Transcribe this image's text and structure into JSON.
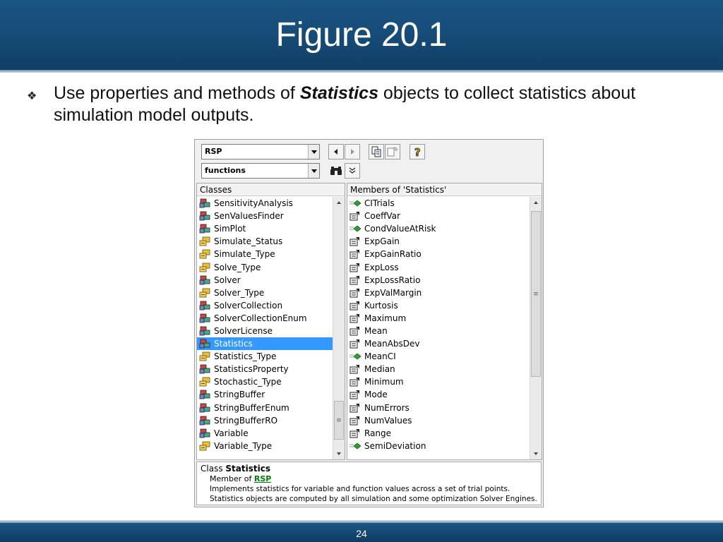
{
  "slide": {
    "title": "Figure 20.1",
    "bullet_part1": "Use properties and methods of ",
    "bullet_emphasis": "Statistics",
    "bullet_part2": " objects to collect statistics about simulation model outputs.",
    "page_number": "24"
  },
  "browser": {
    "library_combo_value": "RSP",
    "search_combo_value": "functions",
    "classes_header": "Classes",
    "members_header": "Members of 'Statistics'",
    "classes": [
      {
        "label": "SensitivityAnalysis",
        "icon": "class-icon"
      },
      {
        "label": "SenValuesFinder",
        "icon": "class-icon"
      },
      {
        "label": "SimPlot",
        "icon": "class-icon"
      },
      {
        "label": "Simulate_Status",
        "icon": "enum-icon"
      },
      {
        "label": "Simulate_Type",
        "icon": "enum-icon"
      },
      {
        "label": "Solve_Type",
        "icon": "enum-icon"
      },
      {
        "label": "Solver",
        "icon": "class-icon"
      },
      {
        "label": "Solver_Type",
        "icon": "enum-icon"
      },
      {
        "label": "SolverCollection",
        "icon": "class-icon"
      },
      {
        "label": "SolverCollectionEnum",
        "icon": "class-icon"
      },
      {
        "label": "SolverLicense",
        "icon": "class-icon"
      },
      {
        "label": "Statistics",
        "icon": "class-icon",
        "selected": true
      },
      {
        "label": "Statistics_Type",
        "icon": "enum-icon"
      },
      {
        "label": "StatisticsProperty",
        "icon": "class-icon"
      },
      {
        "label": "Stochastic_Type",
        "icon": "enum-icon"
      },
      {
        "label": "StringBuffer",
        "icon": "class-icon"
      },
      {
        "label": "StringBufferEnum",
        "icon": "class-icon"
      },
      {
        "label": "StringBufferRO",
        "icon": "class-icon"
      },
      {
        "label": "Variable",
        "icon": "class-icon"
      },
      {
        "label": "Variable_Type",
        "icon": "enum-icon"
      }
    ],
    "members": [
      {
        "label": "CITrials",
        "icon": "method-icon"
      },
      {
        "label": "CoeffVar",
        "icon": "property-icon"
      },
      {
        "label": "CondValueAtRisk",
        "icon": "method-icon"
      },
      {
        "label": "ExpGain",
        "icon": "property-icon"
      },
      {
        "label": "ExpGainRatio",
        "icon": "property-icon"
      },
      {
        "label": "ExpLoss",
        "icon": "property-icon"
      },
      {
        "label": "ExpLossRatio",
        "icon": "property-icon"
      },
      {
        "label": "ExpValMargin",
        "icon": "property-icon"
      },
      {
        "label": "Kurtosis",
        "icon": "property-icon"
      },
      {
        "label": "Maximum",
        "icon": "property-icon"
      },
      {
        "label": "Mean",
        "icon": "property-icon"
      },
      {
        "label": "MeanAbsDev",
        "icon": "property-icon"
      },
      {
        "label": "MeanCI",
        "icon": "method-icon"
      },
      {
        "label": "Median",
        "icon": "property-icon"
      },
      {
        "label": "Minimum",
        "icon": "property-icon"
      },
      {
        "label": "Mode",
        "icon": "property-icon"
      },
      {
        "label": "NumErrors",
        "icon": "property-icon"
      },
      {
        "label": "NumValues",
        "icon": "property-icon"
      },
      {
        "label": "Range",
        "icon": "property-icon"
      },
      {
        "label": "SemiDeviation",
        "icon": "method-icon"
      }
    ],
    "details": {
      "class_prefix": "Class ",
      "class_name": "Statistics",
      "member_of_prefix": "Member of ",
      "member_of_link": "RSP",
      "description": "Implements statistics for variable and function values across a set of trial points. Statistics objects are computed by all simulation and some optimization Solver Engines."
    }
  }
}
